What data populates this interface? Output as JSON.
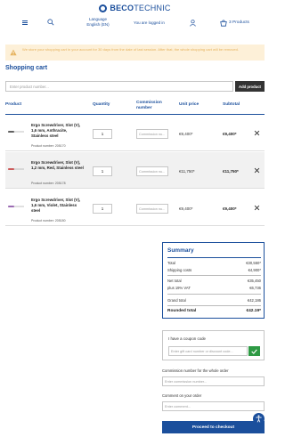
{
  "brand": {
    "name_bold": "BECO",
    "name_thin": "TECHNIC"
  },
  "header": {
    "language_line1": "Language",
    "language_line2": "English (EN)",
    "logged_in": "You are logged in",
    "cart_count": "3 Products"
  },
  "alert": {
    "text": "We store your shopping cart in your account for 30 days from the date of last session. After that, the whole shopping cart will be removed."
  },
  "page_title": "Shopping cart",
  "search": {
    "placeholder": "Enter product number...",
    "add_label": "Add product"
  },
  "columns": {
    "product": "Product",
    "quantity": "Quantity",
    "commission": "Commission number",
    "unit_price": "Unit price",
    "subtotal": "Subtotal"
  },
  "items": [
    {
      "name": "Ergo Screwdriver, Slot (V), 1,6 mm, Anthracite, Stainless steel",
      "product_number": "Product number: 205170",
      "quantity": "1",
      "commission_placeholder": "Commission nu...",
      "unit_price": "€9,400*",
      "subtotal": "€9,400*",
      "color": "#2b2b2b"
    },
    {
      "name": "Ergo Screwdriver, Slot (V), 1,2 mm, Red, Stainless steel",
      "product_number": "Product number: 205178",
      "quantity": "1",
      "commission_placeholder": "Commission nu...",
      "unit_price": "€11,750*",
      "subtotal": "€11,750*",
      "color": "#c02a2a"
    },
    {
      "name": "Ergo Screwdriver, Slot (V), 1,6 mm, Violet, Stainless steel",
      "product_number": "Product number: 205180",
      "quantity": "1",
      "commission_placeholder": "Commission nu...",
      "unit_price": "€9,400*",
      "subtotal": "€9,400*",
      "color": "#7a3b9a"
    }
  ],
  "summary": {
    "title": "Summary",
    "total_label": "Total",
    "total_value": "€30,550*",
    "shipping_label": "Shipping costs",
    "shipping_value": "€4,900*",
    "net_label": "Net total",
    "net_value": "€35,450",
    "vat_label": "plus 19% VAT",
    "vat_value": "€6,736",
    "grand_label": "Grand total",
    "grand_value": "€42,186",
    "rounded_label": "Rounded total",
    "rounded_value": "€42.19*"
  },
  "coupon": {
    "label": "I have a coupon code",
    "placeholder": "Enter gift card number or discount code..."
  },
  "commission_order": {
    "label": "Commission number for the whole order",
    "placeholder": "Enter commission number..."
  },
  "comment": {
    "label": "Comment on your order",
    "placeholder": "Enter comment..."
  },
  "checkout_label": "Proceed to checkout",
  "colors": {
    "brand": "#1b4f9c",
    "alert_bg": "#fdf0d8",
    "alert_text": "#e6b25c",
    "success": "#2e9a44"
  }
}
